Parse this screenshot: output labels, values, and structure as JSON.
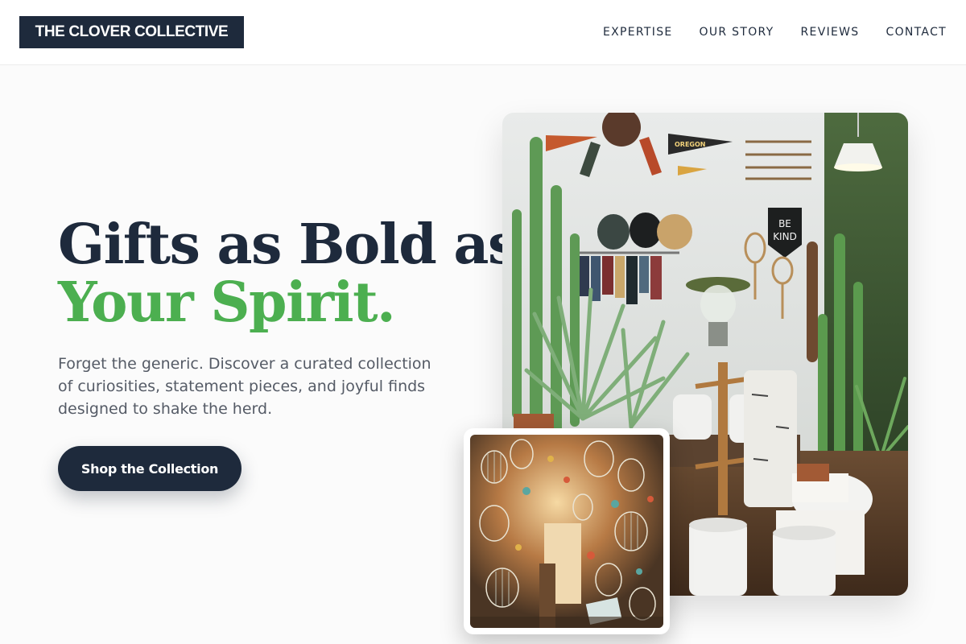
{
  "brand": {
    "name": "THE CLOVER COLLECTIVE"
  },
  "nav": {
    "items": [
      "EXPERTISE",
      "OUR STORY",
      "REVIEWS",
      "CONTACT"
    ]
  },
  "hero": {
    "headline_line1": "Gifts as Bold as",
    "headline_line2": "Your Spirit.",
    "description": "Forget the generic. Discover a curated collection of curiosities, statement pieces, and joyful finds designed to shake the herd.",
    "cta_label": "Shop the Collection"
  },
  "images": {
    "main_pennant_text": "OREGON",
    "main_sign_line1": "BE",
    "main_sign_line2": "KIND"
  },
  "colors": {
    "primary": "#1e2a3c",
    "accent": "#4caf50",
    "text_muted": "#555b66",
    "background": "#fbfbfb"
  }
}
